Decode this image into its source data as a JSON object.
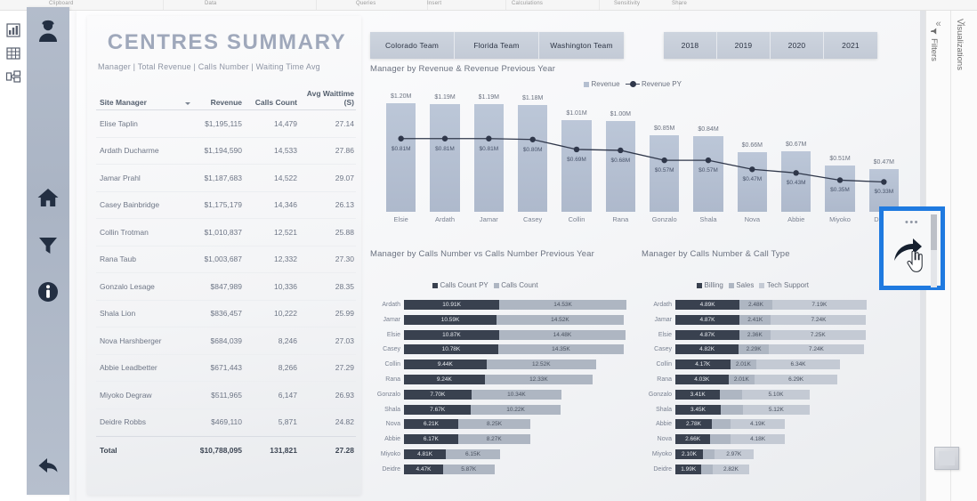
{
  "ribbon": {
    "groups": [
      "Clipboard",
      "Data",
      "Queries",
      "Insert",
      "Calculations",
      "Sensitivity",
      "Share"
    ]
  },
  "view_strip": {
    "items": [
      {
        "name": "report-view-icon",
        "label": "Report"
      },
      {
        "name": "data-view-icon",
        "label": "Data"
      },
      {
        "name": "model-view-icon",
        "label": "Model"
      }
    ]
  },
  "nav_rail": {
    "items": [
      {
        "name": "user-profile-icon",
        "label": "Profile"
      },
      {
        "name": "home-icon",
        "label": "Home"
      },
      {
        "name": "filter-funnel-icon",
        "label": "Filters"
      },
      {
        "name": "info-icon",
        "label": "Info"
      },
      {
        "name": "back-arrow-icon",
        "label": "Back"
      }
    ]
  },
  "summary": {
    "title": "CENTRES SUMMARY",
    "subtitle": "Manager | Total Revenue | Calls Number | Waiting Time Avg",
    "columns": [
      "Site Manager",
      "Revenue",
      "Calls Count",
      "Avg Waittime (S)"
    ],
    "rows": [
      {
        "manager": "Elise Taplin",
        "revenue": "$1,195,115",
        "calls": "14,479",
        "wait": "27.14"
      },
      {
        "manager": "Ardath Ducharme",
        "revenue": "$1,194,590",
        "calls": "14,533",
        "wait": "27.86"
      },
      {
        "manager": "Jamar Prahl",
        "revenue": "$1,187,683",
        "calls": "14,522",
        "wait": "29.07"
      },
      {
        "manager": "Casey Bainbridge",
        "revenue": "$1,175,179",
        "calls": "14,346",
        "wait": "26.13"
      },
      {
        "manager": "Collin Trotman",
        "revenue": "$1,010,837",
        "calls": "12,521",
        "wait": "25.88"
      },
      {
        "manager": "Rana Taub",
        "revenue": "$1,003,687",
        "calls": "12,332",
        "wait": "27.30"
      },
      {
        "manager": "Gonzalo Lesage",
        "revenue": "$847,989",
        "calls": "10,336",
        "wait": "28.35"
      },
      {
        "manager": "Shala Lion",
        "revenue": "$836,457",
        "calls": "10,222",
        "wait": "25.99"
      },
      {
        "manager": "Nova Harshberger",
        "revenue": "$684,039",
        "calls": "8,246",
        "wait": "27.03"
      },
      {
        "manager": "Abbie Leadbetter",
        "revenue": "$671,443",
        "calls": "8,266",
        "wait": "27.29"
      },
      {
        "manager": "Miyoko Degraw",
        "revenue": "$511,965",
        "calls": "6,147",
        "wait": "26.93"
      },
      {
        "manager": "Deidre Robbs",
        "revenue": "$469,110",
        "calls": "5,871",
        "wait": "24.82"
      }
    ],
    "total": {
      "manager": "Total",
      "revenue": "$10,788,095",
      "calls": "131,821",
      "wait": "27.28"
    }
  },
  "team_slicer": {
    "options": [
      "Colorado Team",
      "Florida Team",
      "Washington Team"
    ]
  },
  "year_slicer": {
    "options": [
      "2018",
      "2019",
      "2020",
      "2021"
    ]
  },
  "chart_data": [
    {
      "type": "bar",
      "title": "Manager by Revenue & Revenue Previous Year",
      "categories": [
        "Elsie",
        "Ardath",
        "Jamar",
        "Casey",
        "Collin",
        "Rana",
        "Gonzalo",
        "Shala",
        "Nova",
        "Abbie",
        "Miyoko",
        "Deidre"
      ],
      "series": [
        {
          "name": "Revenue",
          "kind": "column",
          "values": [
            1.2,
            1.19,
            1.19,
            1.18,
            1.01,
            1.0,
            0.85,
            0.84,
            0.66,
            0.67,
            0.51,
            0.47
          ],
          "labels": [
            "$1.20M",
            "$1.19M",
            "$1.19M",
            "$1.18M",
            "$1.01M",
            "$1.00M",
            "$0.85M",
            "$0.84M",
            "$0.66M",
            "$0.67M",
            "$0.51M",
            "$0.47M"
          ]
        },
        {
          "name": "Revenue PY",
          "kind": "line",
          "values": [
            0.81,
            0.81,
            0.81,
            0.8,
            0.69,
            0.68,
            0.57,
            0.57,
            0.47,
            0.43,
            0.35,
            0.33
          ],
          "labels": [
            "$0.81M",
            "$0.81M",
            "$0.81M",
            "$0.80M",
            "$0.69M",
            "$0.68M",
            "$0.57M",
            "$0.57M",
            "$0.47M",
            "$0.43M",
            "$0.35M",
            "$0.33M"
          ]
        }
      ],
      "ylabel": "",
      "xlabel": "",
      "ylim": [
        0,
        1.3
      ],
      "grid": false,
      "legend": "top-right"
    },
    {
      "type": "bar",
      "title": "Manager by Calls Number vs Calls Number Previous Year",
      "orientation": "horizontal",
      "stacked": true,
      "categories": [
        "Ardath",
        "Jamar",
        "Elsie",
        "Casey",
        "Collin",
        "Rana",
        "Gonzalo",
        "Shala",
        "Nova",
        "Abbie",
        "Miyoko",
        "Deidre"
      ],
      "series": [
        {
          "name": "Calls Count PY",
          "values": [
            10.91,
            10.59,
            10.87,
            10.78,
            9.44,
            9.24,
            7.7,
            7.67,
            6.21,
            6.17,
            4.81,
            4.47
          ],
          "labels": [
            "10.91K",
            "10.59K",
            "10.87K",
            "10.78K",
            "9.44K",
            "9.24K",
            "7.70K",
            "7.67K",
            "6.21K",
            "6.17K",
            "4.81K",
            "4.47K"
          ]
        },
        {
          "name": "Calls Count",
          "values": [
            14.53,
            14.52,
            14.48,
            14.35,
            12.52,
            12.33,
            10.34,
            10.22,
            8.25,
            8.27,
            6.15,
            5.87
          ],
          "labels": [
            "14.53K",
            "14.52K",
            "14.48K",
            "14.35K",
            "12.52K",
            "12.33K",
            "10.34K",
            "10.22K",
            "8.25K",
            "8.27K",
            "6.15K",
            "5.87K"
          ]
        }
      ],
      "legend": "top-center"
    },
    {
      "type": "bar",
      "title": "Manager by Calls Number & Call Type",
      "orientation": "horizontal",
      "stacked": true,
      "categories": [
        "Ardath",
        "Jamar",
        "Elsie",
        "Casey",
        "Collin",
        "Rana",
        "Gonzalo",
        "Shala",
        "Abbie",
        "Nova",
        "Miyoko",
        "Deidre"
      ],
      "series": [
        {
          "name": "Billing",
          "values": [
            4.89,
            4.87,
            4.87,
            4.82,
            4.17,
            4.03,
            3.41,
            3.45,
            2.78,
            2.66,
            2.1,
            1.99
          ],
          "labels": [
            "4.89K",
            "4.87K",
            "4.87K",
            "4.82K",
            "4.17K",
            "4.03K",
            "3.41K",
            "3.45K",
            "2.78K",
            "2.66K",
            "2.10K",
            "1.99K"
          ]
        },
        {
          "name": "Sales",
          "values": [
            2.48,
            2.41,
            2.36,
            2.29,
            2.01,
            2.01,
            1.69,
            1.67,
            1.39,
            1.52,
            0.87,
            0.83
          ],
          "labels": [
            "2.48K",
            "2.41K",
            "2.36K",
            "2.29K",
            "2.01K",
            "2.01K",
            "",
            "",
            "",
            "",
            "",
            ""
          ]
        },
        {
          "name": "Tech Support",
          "values": [
            7.19,
            7.24,
            7.25,
            7.24,
            6.34,
            6.29,
            5.1,
            5.12,
            4.19,
            4.18,
            2.97,
            2.82
          ],
          "labels": [
            "7.19K",
            "7.24K",
            "7.25K",
            "7.24K",
            "6.34K",
            "6.29K",
            "5.10K",
            "5.12K",
            "4.19K",
            "4.18K",
            "2.97K",
            "2.82K"
          ]
        }
      ],
      "legend": "top-center"
    }
  ],
  "highlight": {
    "ellipsis": "•••",
    "arrow_icon": "drill-through-arrow-icon"
  },
  "panes": {
    "filters": {
      "label": "Filters",
      "chevron": "«"
    },
    "visualizations": {
      "label": "Visualizations",
      "chevron": "‹"
    }
  },
  "colors": {
    "accent_highlight": "#1f7ae0",
    "bar_primary": "#b4bfd0",
    "line_dark": "#2f374a",
    "seg_dark": "#39414f",
    "seg_mid": "#aeb6c2",
    "seg_light": "#c4cad4",
    "title_text": "#9fa8bb"
  }
}
